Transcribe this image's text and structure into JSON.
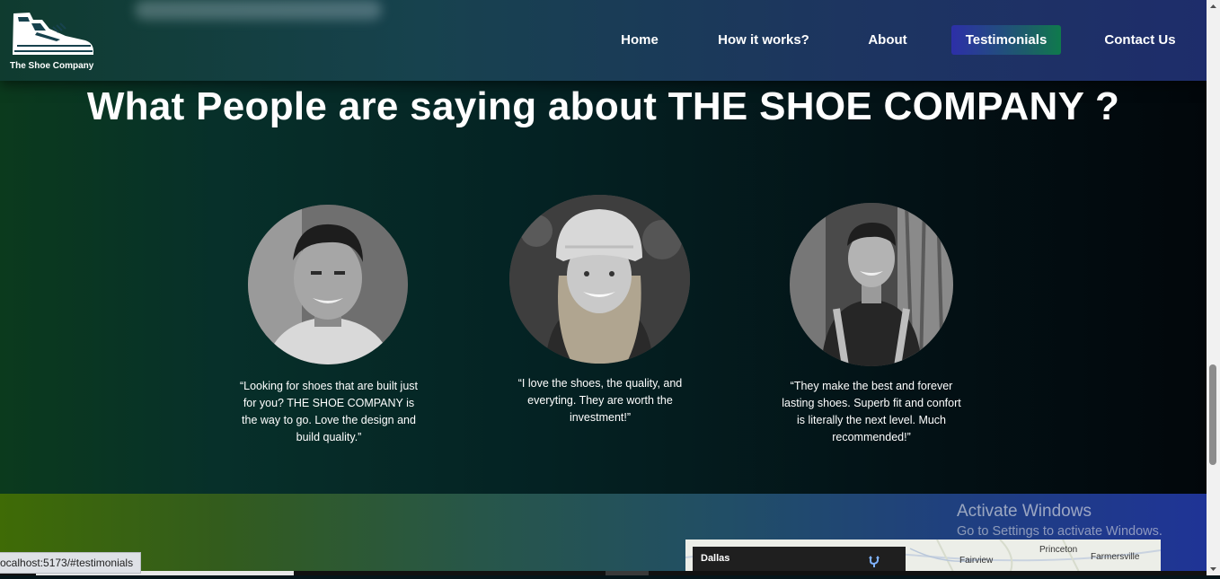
{
  "brand": {
    "name": "The Shoe Company",
    "logo_icon": "sneaker-icon"
  },
  "nav": {
    "items": [
      {
        "label": "Home",
        "active": false
      },
      {
        "label": "How it works?",
        "active": false
      },
      {
        "label": "About",
        "active": false
      },
      {
        "label": "Testimonials",
        "active": true
      },
      {
        "label": "Contact Us",
        "active": false
      }
    ]
  },
  "testimonials": {
    "title": "What People are saying about THE SHOE COMPANY ?",
    "items": [
      {
        "avatar": "man-portrait-photo",
        "quote": "“Looking for shoes that are built just for you? THE SHOE COMPANY is the way to go. Love the design and build quality.”"
      },
      {
        "avatar": "woman-portrait-photo",
        "quote": "“I love the shoes, the quality, and everyting. They are worth the investment!”"
      },
      {
        "avatar": "young-man-portrait-photo",
        "quote": "“They make the best and forever lasting shoes. Superb fit and confort is literally the next level. Much recommended!”"
      }
    ]
  },
  "map": {
    "panel_title": "Dallas",
    "panel_icon": "directions-icon",
    "places": [
      "Princeton",
      "Farmersville",
      "Fairview"
    ]
  },
  "os_watermark": {
    "title": "Activate Windows",
    "subtitle": "Go to Settings to activate Windows."
  },
  "status_bar": {
    "url": "ocalhost:5173/#testimonials"
  },
  "colors": {
    "header_start": "#0f3b2f",
    "header_end": "#1e2d6b",
    "active_tab_start": "#2d2fa8",
    "active_tab_end": "#0f7a4c",
    "section_bg_left": "#0b3a1d",
    "section_bg_right": "#02070b"
  }
}
